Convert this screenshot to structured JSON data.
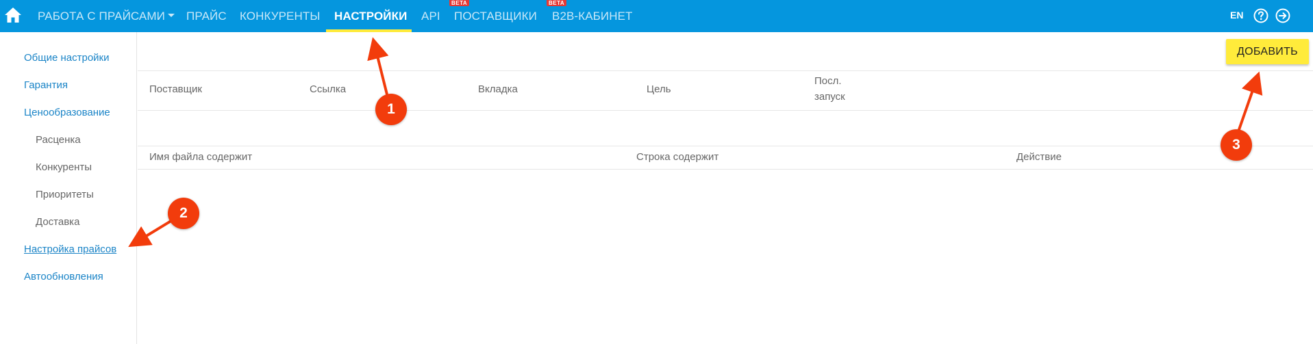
{
  "topnav": {
    "items": [
      {
        "label": "РАБОТА С ПРАЙСАМИ"
      },
      {
        "label": "ПРАЙС"
      },
      {
        "label": "КОНКУРЕНТЫ"
      },
      {
        "label": "НАСТРОЙКИ"
      },
      {
        "label": "API"
      },
      {
        "label": "ПОСТАВЩИКИ"
      },
      {
        "label": "B2B-КАБИНЕТ"
      }
    ],
    "beta_label": "BETA",
    "lang": "EN",
    "icons": [
      "home-icon",
      "help-icon",
      "logout-icon"
    ]
  },
  "sidebar": {
    "items": [
      {
        "label": "Общие настройки"
      },
      {
        "label": "Гарантия"
      },
      {
        "label": "Ценообразование"
      },
      {
        "label": "Расценка"
      },
      {
        "label": "Конкуренты"
      },
      {
        "label": "Приоритеты"
      },
      {
        "label": "Доставка"
      },
      {
        "label": "Настройка прайсов"
      },
      {
        "label": "Автообновления"
      }
    ]
  },
  "main": {
    "add_button": "ДОБАВИТЬ",
    "table1": {
      "columns": [
        "Поставщик",
        "Ссылка",
        "Вкладка",
        "Цель",
        "Посл.",
        "запуск"
      ]
    },
    "table2": {
      "columns": [
        "Имя файла содержит",
        "Строка содержит",
        "Действие"
      ]
    }
  },
  "annotations": [
    "1",
    "2",
    "3"
  ],
  "colors": {
    "header": "#0596de",
    "accent": "#ffeb3b",
    "link": "#1a84c7",
    "annotation": "#f23c0c"
  }
}
